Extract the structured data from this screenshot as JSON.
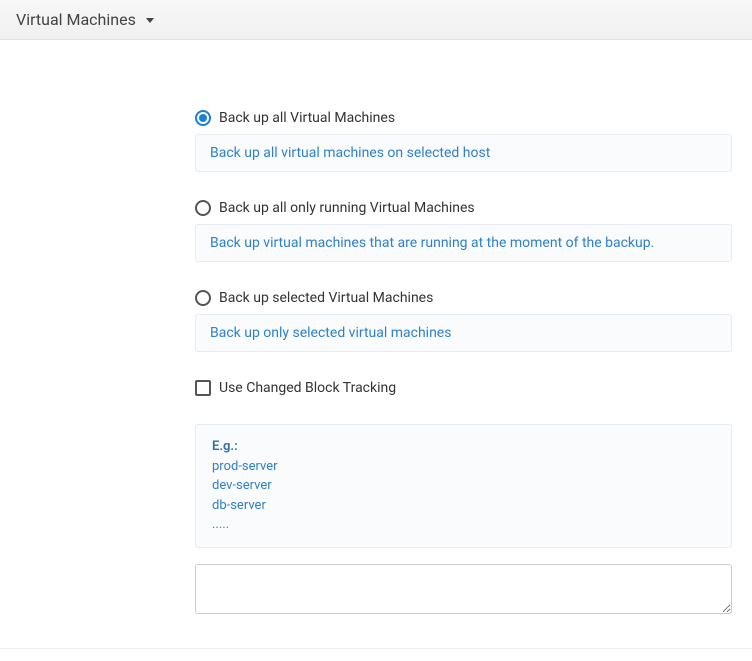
{
  "header": {
    "title": "Virtual Machines"
  },
  "options": [
    {
      "label": "Back up all Virtual Machines",
      "description": "Back up all virtual machines on selected host",
      "selected": true
    },
    {
      "label": "Back up all only running Virtual Machines",
      "description": "Back up virtual machines that are running at the moment of the backup.",
      "selected": false
    },
    {
      "label": "Back up selected Virtual Machines",
      "description": "Back up only selected virtual machines",
      "selected": false
    }
  ],
  "checkbox": {
    "label": "Use Changed Block Tracking",
    "checked": false
  },
  "example": {
    "title": "E.g.:",
    "lines": [
      "prod-server",
      "dev-server",
      "db-server",
      "....."
    ]
  },
  "textarea": {
    "value": ""
  }
}
